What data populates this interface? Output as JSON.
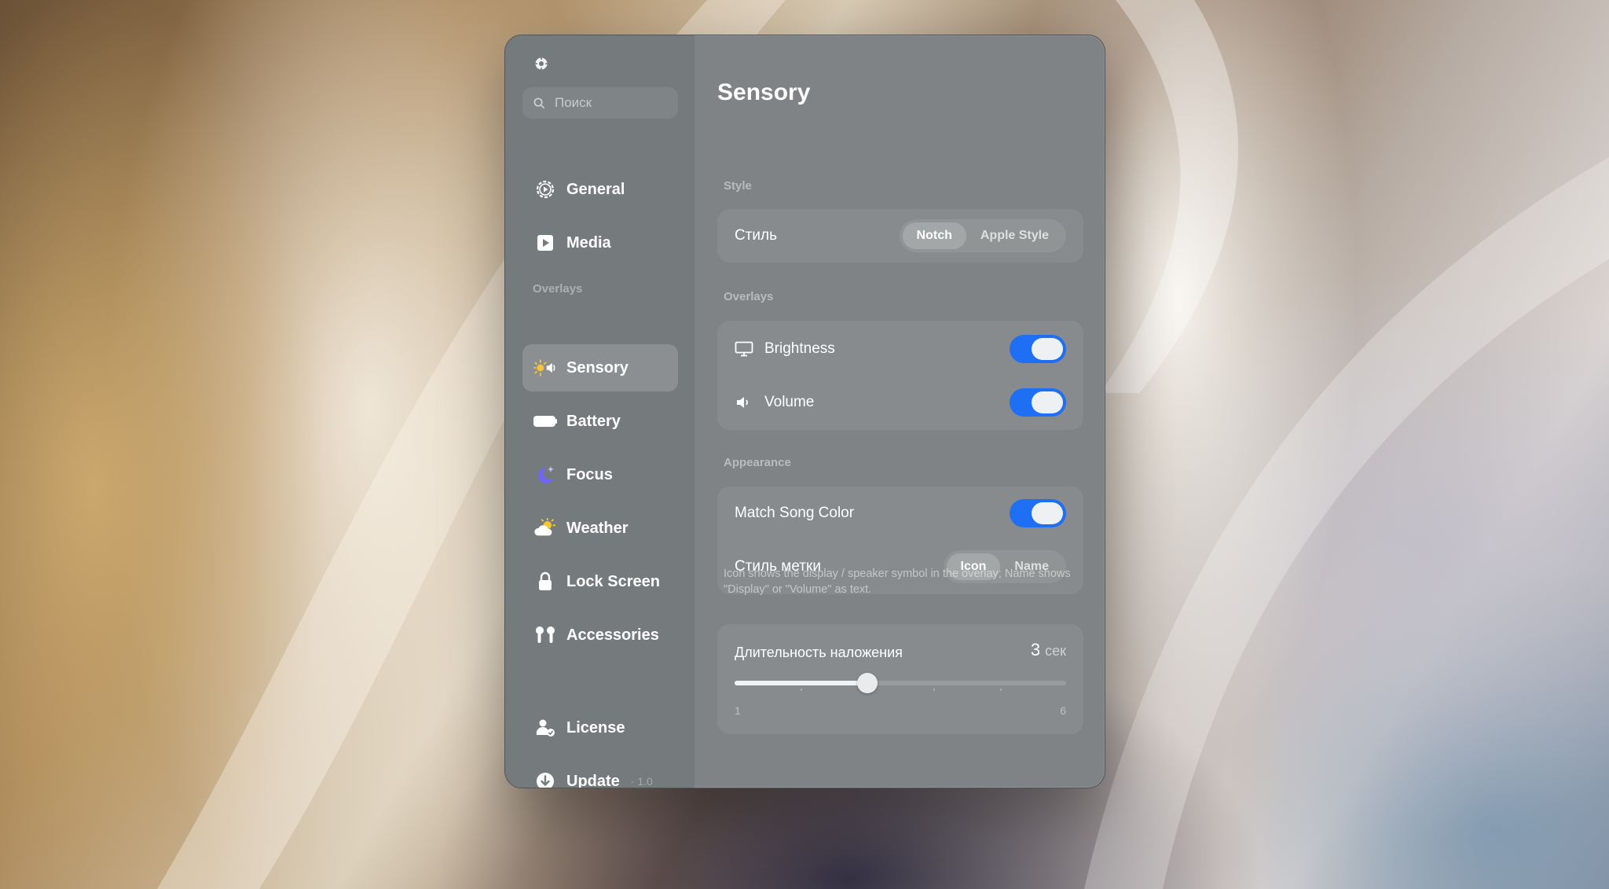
{
  "sidebar": {
    "search_placeholder": "Поиск",
    "items": [
      {
        "label": "General",
        "icon": "gear-play-icon"
      },
      {
        "label": "Media",
        "icon": "play-square-icon"
      }
    ],
    "overlays_label": "Overlays",
    "overlay_items": [
      {
        "label": "Sensory",
        "icon": "sun-speaker-icon",
        "active": true
      },
      {
        "label": "Battery",
        "icon": "battery-icon"
      },
      {
        "label": "Focus",
        "icon": "moon-icon"
      },
      {
        "label": "Weather",
        "icon": "sun-cloud-icon"
      },
      {
        "label": "Lock Screen",
        "icon": "lock-icon"
      },
      {
        "label": "Accessories",
        "icon": "airpods-icon"
      }
    ],
    "bottom_items": [
      {
        "label": "License",
        "icon": "person-badge-icon"
      },
      {
        "label": "Update",
        "icon": "download-circle-icon",
        "version": "1.0"
      }
    ]
  },
  "main": {
    "title": "Sensory",
    "style_group": {
      "label": "Style",
      "row_label": "Стиль",
      "options": [
        "Notch",
        "Apple Style"
      ],
      "selected": "Notch"
    },
    "overlays_group": {
      "label": "Overlays",
      "rows": [
        {
          "label": "Brightness",
          "icon": "display-icon",
          "on": true
        },
        {
          "label": "Volume",
          "icon": "speaker-icon",
          "on": true
        }
      ]
    },
    "appearance_group": {
      "label": "Appearance",
      "match_song_color": {
        "label": "Match Song Color",
        "on": true
      },
      "badge_style": {
        "label": "Стиль метки",
        "options": [
          "Icon",
          "Name"
        ],
        "selected": "Icon"
      },
      "hint": "Icon shows the display / speaker symbol in the overlay; Name shows \"Display\" or \"Volume\" as text."
    },
    "duration": {
      "label": "Длительность наложения",
      "value": 3,
      "unit": "сек",
      "min": 1,
      "max": 6
    }
  },
  "colors": {
    "accent": "#1e6ff4",
    "window_bg": "#7f8385",
    "sidebar_bg": "#757a7c"
  }
}
